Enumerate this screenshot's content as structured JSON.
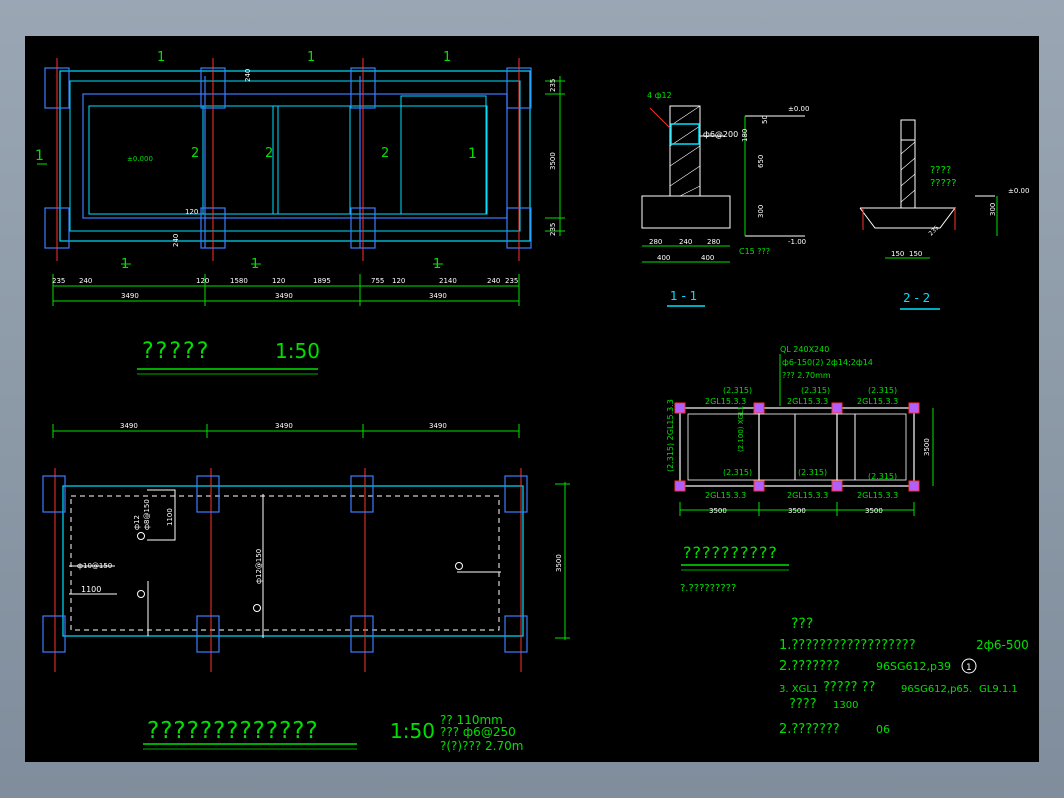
{
  "drawing1": {
    "title": "?????",
    "scale": "1:50",
    "cut_labels": [
      "1",
      "1",
      "1",
      "1",
      "1",
      "1",
      "1",
      "1",
      "2",
      "2",
      "2"
    ],
    "elev_label": "±0.000",
    "dims_bottom": [
      "235",
      "240",
      "120",
      "1580",
      "120",
      "1895",
      "755",
      "120",
      "2140",
      "240",
      "235"
    ],
    "spans": [
      "3490",
      "3490",
      "3490"
    ],
    "dims_right": [
      "235",
      "3500",
      "235"
    ],
    "dims_inner": [
      "240",
      "120",
      "240"
    ]
  },
  "drawing2": {
    "title": "?????????????",
    "scale": "1:50",
    "spans": [
      "3490",
      "3490",
      "3490"
    ],
    "height": "3500",
    "dim_1100_a": "1100",
    "dim_1100_b": "1100",
    "rebar_a": "ф12",
    "rebar_b": "ф8@150",
    "rebar_c": "ф10@150",
    "rebar_d": "ф12@150",
    "notes": [
      "?? 110mm",
      "??? ф6@250",
      "?(?)??? 2.70m"
    ]
  },
  "section1": {
    "label": "1 - 1",
    "rebar": "4 ф12",
    "stirrup": "ф6@200",
    "elev_top": "±0.00",
    "elev_bottom": "-1.00",
    "dims_v": [
      "50",
      "180",
      "650",
      "300"
    ],
    "dims_h": [
      "280",
      "240",
      "280",
      "400",
      "400"
    ],
    "concrete": "C15 ???"
  },
  "section2": {
    "label": "2 - 2",
    "note_a": "????",
    "note_b": "?????",
    "elev": "±0.00",
    "dim_v": "300",
    "dims_h": [
      "150",
      "150"
    ],
    "slope": "235"
  },
  "drawing3": {
    "title": "??????????",
    "subtitle": "?.?????????",
    "header": [
      "QL 240X240",
      "ф6-150(2) 2ф14;2ф14",
      "??? 2.70mm"
    ],
    "elevations": [
      "(2.315)",
      "(2.315)",
      "(2.315)",
      "(2.315)",
      "(2.315)",
      "(2.315)"
    ],
    "beams_top": [
      "2GL15.3.3",
      "2GL15.3.3",
      "2GL15.3.3"
    ],
    "beams_bottom": [
      "2GL15.3.3",
      "2GL15.3.3",
      "2GL15.3.3"
    ],
    "left_label": "(2.315) 2GL15.3.3",
    "mid_label": "(2.100) XGL1",
    "spans": [
      "3500",
      "3500",
      "3500"
    ],
    "height": "3500"
  },
  "notes": {
    "title": "???",
    "lines": [
      "1.??????????????????",
      "2.???????",
      "3. XGL1",
      "????",
      "2.???????"
    ],
    "line1_value": "2ф6-500",
    "line2_value": "96SG612,p39",
    "line2_circle": "1",
    "line3_mid": "????? ??",
    "line3_value": "96SG612,p65.",
    "line3_value2": "GL9.1.1",
    "line4_value": "1300",
    "line5_value": "06"
  }
}
